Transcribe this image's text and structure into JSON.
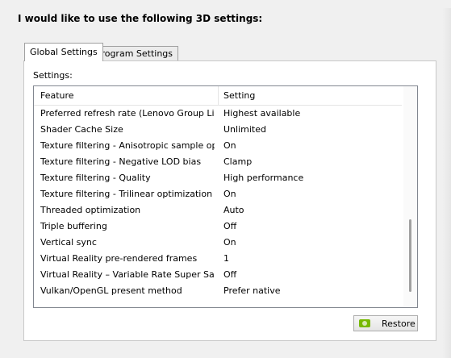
{
  "heading": "I would like to use the following 3D settings:",
  "tabs": [
    {
      "label": "Global Settings",
      "active": true
    },
    {
      "label": "Program Settings",
      "active": false
    }
  ],
  "settings_label": "Settings:",
  "columns": {
    "feature": "Feature",
    "setting": "Setting"
  },
  "rows": [
    {
      "feature": "Preferred refresh rate (Lenovo Group Limi...",
      "setting": "Highest available"
    },
    {
      "feature": "Shader Cache Size",
      "setting": "Unlimited"
    },
    {
      "feature": "Texture filtering - Anisotropic sample opti...",
      "setting": "On"
    },
    {
      "feature": "Texture filtering - Negative LOD bias",
      "setting": "Clamp"
    },
    {
      "feature": "Texture filtering - Quality",
      "setting": "High performance"
    },
    {
      "feature": "Texture filtering - Trilinear optimization",
      "setting": "On"
    },
    {
      "feature": "Threaded optimization",
      "setting": "Auto"
    },
    {
      "feature": "Triple buffering",
      "setting": "Off"
    },
    {
      "feature": "Vertical sync",
      "setting": "On"
    },
    {
      "feature": "Virtual Reality pre-rendered frames",
      "setting": "1"
    },
    {
      "feature": "Virtual Reality – Variable Rate Super Samp...",
      "setting": "Off"
    },
    {
      "feature": "Vulkan/OpenGL present method",
      "setting": "Prefer native"
    }
  ],
  "restore_button": {
    "label": "Restore",
    "icon": "nvidia-logo-icon"
  },
  "colors": {
    "nvidia_green": "#76b900"
  }
}
